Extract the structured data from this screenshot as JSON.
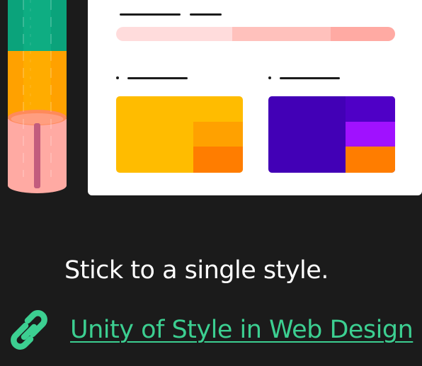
{
  "illustration": {
    "tube_colors": [
      "#0ba37b",
      "#ffa100",
      "#ffaaa3"
    ],
    "progress_colors": [
      "#ffdcdc",
      "#ffc1bc",
      "#ffaaa3"
    ],
    "block_colors": {
      "yellow": [
        "#ffbc00",
        "#ffa100",
        "#ff7d00"
      ],
      "purple": [
        "#4200b6",
        "#a011ff",
        "#ff7d00"
      ]
    }
  },
  "caption": "Stick to a single style.",
  "link": {
    "icon": "link-icon",
    "label": "Unity of Style in Web Design",
    "color": "#3ccf91"
  }
}
